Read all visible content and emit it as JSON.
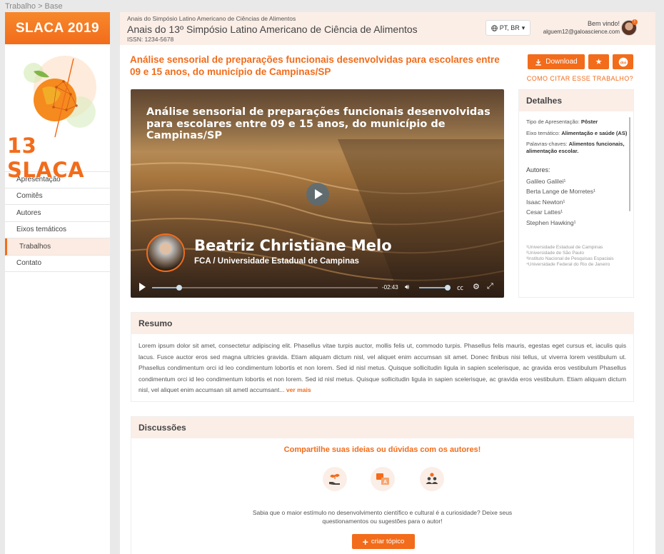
{
  "breadcrumb": "Trabalho > Base",
  "sidebar": {
    "brand": "SLACA 2019",
    "logo_text": "13 SLACA",
    "items": [
      {
        "label": "Apresentação"
      },
      {
        "label": "Comitês"
      },
      {
        "label": "Autores"
      },
      {
        "label": "Eixos temáticos"
      },
      {
        "label": "Trabalhos"
      },
      {
        "label": "Contato"
      }
    ]
  },
  "header": {
    "subtitle": "Anais do Simpósio Latino Americano de Ciências de Alimentos",
    "title": "Anais do 13º Simpósio Latino Americano de Ciência de Alimentos",
    "issn": "ISSN: 1234-5678",
    "language": "PT, BR",
    "welcome": "Bem vindo!",
    "email": "alguem12@galoascience.com"
  },
  "work": {
    "title": "Análise sensorial de preparações funcionais desenvolvidas para escolares entre 09 e 15 anos, do município de Campinas/SP",
    "download_label": "Download",
    "cite_label": "COMO CITAR ESSE TRABALHO?"
  },
  "video": {
    "title": "Análise sensorial de preparações funcionais desenvolvidas para escolares entre 09 e 15 anos, do município de Campinas/SP",
    "presenter_name": "Beatriz Christiane Melo",
    "presenter_inst": "FCA / Universidade Estadual de Campinas",
    "time_remaining": "-02:43",
    "progress": 0.12,
    "volume": 0.9
  },
  "details": {
    "heading": "Detalhes",
    "tipo_label": "Tipo de Apresentação:",
    "tipo_value": "Pôster",
    "eixo_label": "Eixo temático:",
    "eixo_value": "Alimentação e saúde (AS)",
    "palavras_label": "Palavras-chaves:",
    "palavras_value": "Alimentos funcionais, alimentação escolar.",
    "authors_heading": "Autores:",
    "authors": [
      "Galileo Galilei¹",
      "Berta Lange de Morretes¹",
      "Isaac Newton¹",
      "Cesar Lattes¹",
      "Stephen Hawking¹"
    ],
    "affiliations": [
      "¹Universidade Estadual de Campinas",
      "²Universidade de São Paulo",
      "³Instituto Nacional de Pesquisas Espaciais",
      "⁴Universidade Federal do Rio de Janeiro"
    ]
  },
  "resumo": {
    "heading": "Resumo",
    "text": "Lorem ipsum dolor sit amet, consectetur adipiscing elit. Phasellus vitae turpis auctor, mollis felis ut, commodo turpis. Phasellus felis mauris, egestas eget cursus et, iaculis quis lacus. Fusce auctor eros sed magna ultricies gravida. Etiam aliquam dictum nisl, vel aliquet enim accumsan sit amet. Donec finibus nisi tellus, ut viverra lorem vestibulum ut.  Phasellus condimentum orci id leo condimentum lobortis et non lorem. Sed id nisl metus. Quisque sollicitudin ligula in sapien scelerisque, ac gravida eros vestibulum Phasellus condimentum orci id leo condimentum lobortis et non lorem. Sed id nisl metus. Quisque sollicitudin ligula in sapien scelerisque, ac gravida eros vestibulum.  Etiam aliquam dictum nisl, vel aliquet enim accumsan sit ametl accumsant...",
    "more_label": "ver mais"
  },
  "discussoes": {
    "heading": "Discussões",
    "cta": "Compartilhe suas ideias ou dúvidas com os autores!",
    "note_line1": "Sabia que o maior estímulo no desenvolvimento científico e cultural é a curiosidade? Deixe seus",
    "note_line2": "questionamentos ou sugestões para o autor!",
    "button_label": "criar tópico"
  },
  "colors": {
    "accent": "#f26c1b",
    "header_bg": "#fbeee7",
    "page_bg": "#e9e9e9"
  },
  "icons": [
    "download-icon",
    "star-icon",
    "doi-icon",
    "globe-icon",
    "play-icon",
    "volume-icon",
    "captions-icon",
    "settings-icon",
    "fullscreen-icon",
    "seedling-hand-icon",
    "translate-icon",
    "people-icon",
    "plus-icon"
  ]
}
